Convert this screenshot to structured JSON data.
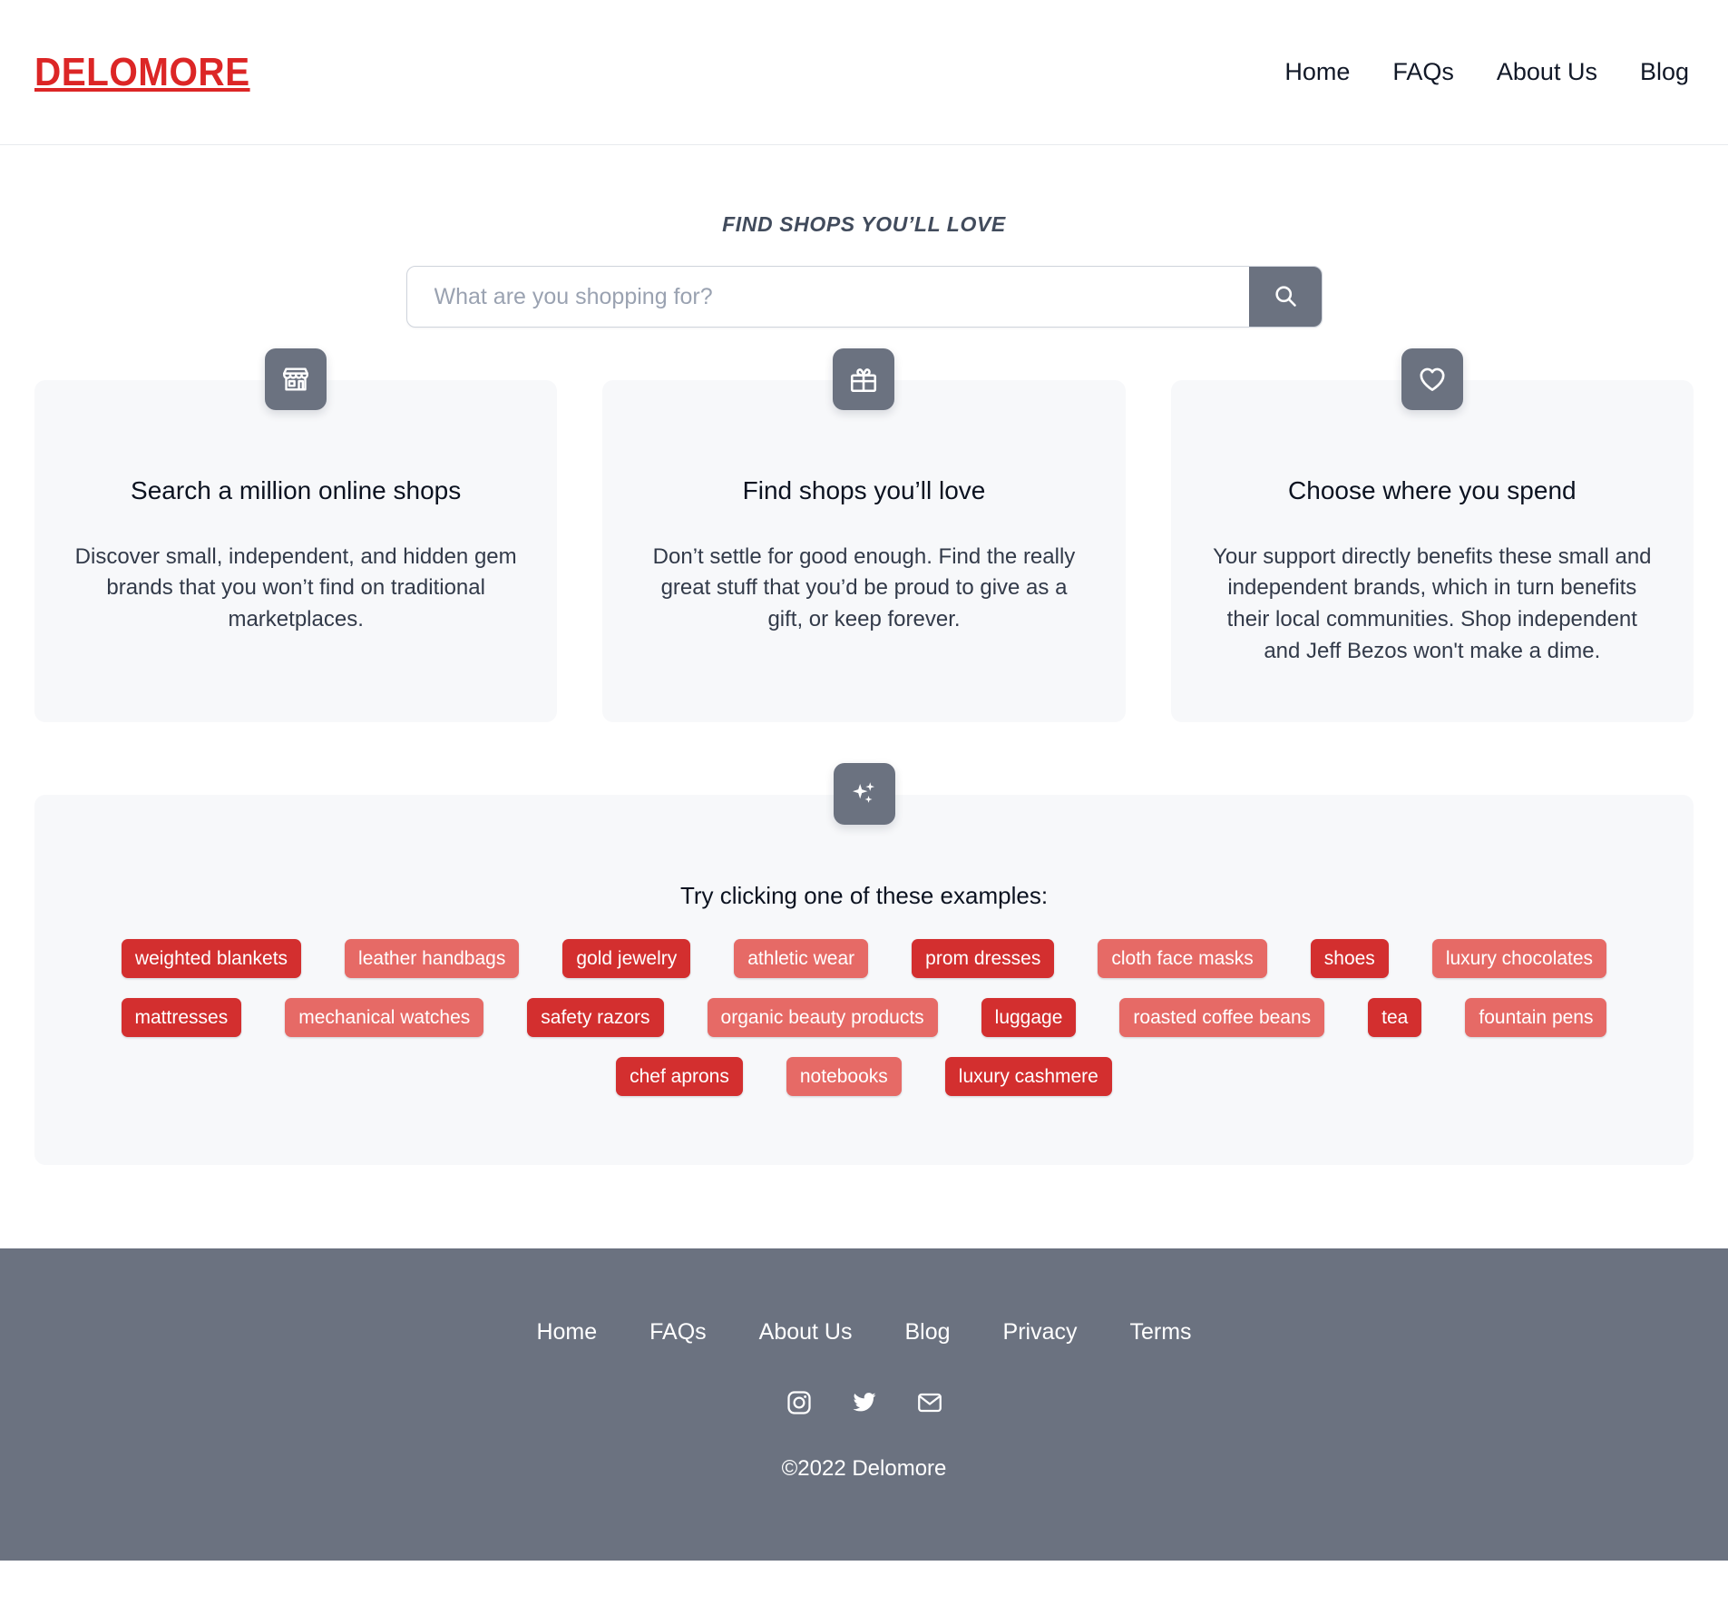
{
  "brand": {
    "logo": "DELOMORE",
    "accent_color": "#dc2626",
    "slate_color": "#6b7280",
    "tag_dark": "#d32f2f",
    "tag_light": "#e66a66",
    "panel_bg": "#f7f8fa"
  },
  "header": {
    "nav": [
      {
        "label": "Home"
      },
      {
        "label": "FAQs"
      },
      {
        "label": "About Us"
      },
      {
        "label": "Blog"
      }
    ]
  },
  "hero": {
    "eyebrow": "FIND SHOPS YOU’LL LOVE",
    "search_placeholder": "What are you shopping for?",
    "search_value": "",
    "search_icon": "search-icon"
  },
  "features": [
    {
      "icon": "storefront-icon",
      "title": "Search a million online shops",
      "text": "Discover small, independent, and hidden gem brands that you won’t find on traditional marketplaces."
    },
    {
      "icon": "gift-icon",
      "title": "Find shops you’ll love",
      "text": "Don’t settle for good enough. Find the really great stuff that you’d be proud to give as a gift, or keep forever."
    },
    {
      "icon": "heart-icon",
      "title": "Choose where you spend",
      "text": "Your support directly benefits these small and independent brands, which in turn benefits their local communities. Shop independent and Jeff Bezos won't make a dime."
    }
  ],
  "examples": {
    "icon": "sparkles-icon",
    "title": "Try clicking one of these examples:",
    "rows": [
      [
        {
          "label": "weighted blankets",
          "variant": "dark"
        },
        {
          "label": "leather handbags",
          "variant": "light"
        },
        {
          "label": "gold jewelry",
          "variant": "dark"
        },
        {
          "label": "athletic wear",
          "variant": "light"
        },
        {
          "label": "prom dresses",
          "variant": "dark"
        },
        {
          "label": "cloth face masks",
          "variant": "light"
        },
        {
          "label": "shoes",
          "variant": "dark"
        },
        {
          "label": "luxury chocolates",
          "variant": "light"
        }
      ],
      [
        {
          "label": "mattresses",
          "variant": "dark"
        },
        {
          "label": "mechanical watches",
          "variant": "light"
        },
        {
          "label": "safety razors",
          "variant": "dark"
        },
        {
          "label": "organic beauty products",
          "variant": "light"
        },
        {
          "label": "luggage",
          "variant": "dark"
        },
        {
          "label": "roasted coffee beans",
          "variant": "light"
        },
        {
          "label": "tea",
          "variant": "dark"
        },
        {
          "label": "fountain pens",
          "variant": "light"
        }
      ],
      [
        {
          "label": "chef aprons",
          "variant": "dark"
        },
        {
          "label": "notebooks",
          "variant": "light"
        },
        {
          "label": "luxury cashmere",
          "variant": "dark"
        }
      ]
    ]
  },
  "footer": {
    "links": [
      {
        "label": "Home"
      },
      {
        "label": "FAQs"
      },
      {
        "label": "About Us"
      },
      {
        "label": "Blog"
      },
      {
        "label": "Privacy"
      },
      {
        "label": "Terms"
      }
    ],
    "socials": [
      {
        "name": "instagram-icon"
      },
      {
        "name": "twitter-icon"
      },
      {
        "name": "email-icon"
      }
    ],
    "copyright": "©2022 Delomore"
  }
}
